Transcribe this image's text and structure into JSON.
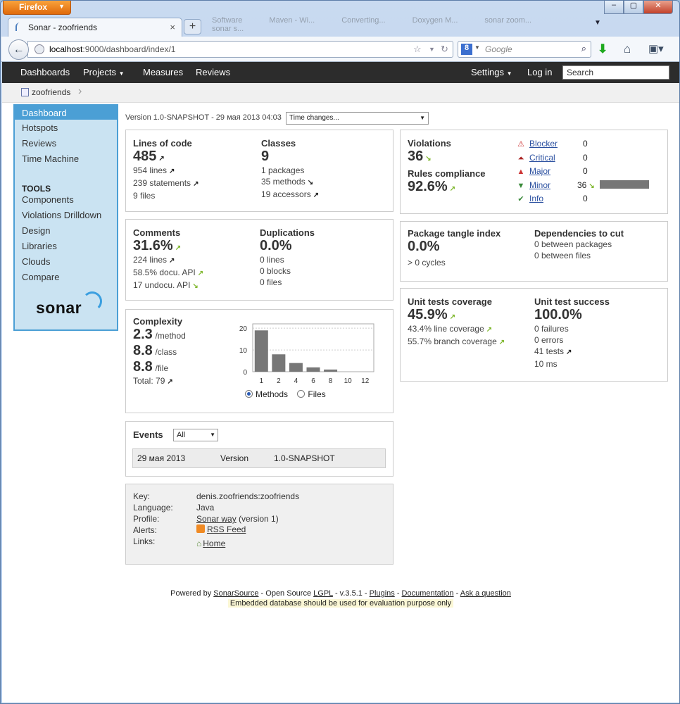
{
  "browser": {
    "app_button": "Firefox",
    "tab_title": "Sonar - zoofriends",
    "new_tab": "+",
    "url_host": "localhost",
    "url_path": ":9000/dashboard/index/1",
    "search_placeholder": "Google",
    "search_engine_letter": "8",
    "ghost_tabs": [
      "Software",
      "Maven - Wi...",
      "Converting...",
      "Doxygen M...",
      "sonar zoom...",
      "sonar s..."
    ]
  },
  "topmenu": {
    "dashboards": "Dashboards",
    "projects": "Projects",
    "measures": "Measures",
    "reviews": "Reviews",
    "settings": "Settings",
    "login": "Log in",
    "search_placeholder": "Search"
  },
  "breadcrumb": {
    "project": "zoofriends"
  },
  "sidebar": {
    "dashboard": "Dashboard",
    "hotspots": "Hotspots",
    "reviews": "Reviews",
    "time_machine": "Time Machine",
    "tools_title": "TOOLS",
    "components": "Components",
    "violations_drilldown": "Violations Drilldown",
    "design": "Design",
    "libraries": "Libraries",
    "clouds": "Clouds",
    "compare": "Compare",
    "logo": "sonar"
  },
  "header": {
    "version": "Version 1.0-SNAPSHOT - 29 мая 2013 04:03",
    "time_changes": "Time changes..."
  },
  "size": {
    "loc_title": "Lines of code",
    "loc_value": "485",
    "lines": "954 lines",
    "statements": "239 statements",
    "files": "9 files",
    "classes_title": "Classes",
    "classes_value": "9",
    "packages": "1 packages",
    "methods": "35 methods",
    "accessors": "19 accessors"
  },
  "violations": {
    "title": "Violations",
    "value": "36",
    "rules_title": "Rules compliance",
    "rules_value": "92.6%",
    "blocker": "Blocker",
    "blocker_count": "0",
    "critical": "Critical",
    "critical_count": "0",
    "major": "Major",
    "major_count": "0",
    "minor": "Minor",
    "minor_count": "36",
    "info": "Info",
    "info_count": "0"
  },
  "comments": {
    "title": "Comments",
    "value": "31.6%",
    "lines": "224 lines",
    "docu_api": "58.5% docu. API",
    "undocu_api": "17 undocu. API",
    "dup_title": "Duplications",
    "dup_value": "0.0%",
    "dup_lines": "0 lines",
    "dup_blocks": "0 blocks",
    "dup_files": "0 files"
  },
  "design": {
    "tangle_title": "Package tangle index",
    "tangle_value": "0.0%",
    "cycles": "> 0 cycles",
    "deps_title": "Dependencies to cut",
    "between_packages": "0 between packages",
    "between_files": "0 between files"
  },
  "complexity": {
    "title": "Complexity",
    "per_method": "2.3",
    "per_method_unit": "/method",
    "per_class": "8.8",
    "per_class_unit": "/class",
    "per_file": "8.8",
    "per_file_unit": "/file",
    "total": "Total: 79",
    "radio_methods": "Methods",
    "radio_files": "Files"
  },
  "tests": {
    "coverage_title": "Unit tests coverage",
    "coverage_value": "45.9%",
    "line_coverage": "43.4% line coverage",
    "branch_coverage": "55.7% branch coverage",
    "success_title": "Unit test success",
    "success_value": "100.0%",
    "failures": "0 failures",
    "errors": "0 errors",
    "tests": "41 tests",
    "duration": "10 ms"
  },
  "events": {
    "title": "Events",
    "filter": "All",
    "date": "29 мая 2013",
    "category": "Version",
    "name": "1.0-SNAPSHOT"
  },
  "info": {
    "key_label": "Key:",
    "key": "denis.zoofriends:zoofriends",
    "language_label": "Language:",
    "language": "Java",
    "profile_label": "Profile:",
    "profile_link": "Sonar way",
    "profile_version": "(version 1)",
    "alerts_label": "Alerts:",
    "rss": "RSS Feed",
    "links_label": "Links:",
    "home": "Home"
  },
  "footer": {
    "powered_by": "Powered by",
    "sonarsource": "SonarSource",
    "open_source": "- Open Source",
    "lgpl": "LGPL",
    "version": "- v.3.5.1 -",
    "plugins": "Plugins",
    "documentation": "Documentation",
    "ask": "Ask a question",
    "sep": "-",
    "warning": "Embedded database should be used for evaluation purpose only"
  },
  "chart_data": {
    "type": "bar",
    "categories": [
      "1",
      "2",
      "4",
      "6",
      "8",
      "10",
      "12"
    ],
    "values": [
      19,
      8,
      4,
      2,
      1,
      0,
      0
    ],
    "ylim": [
      0,
      22
    ],
    "yticks": [
      "0",
      "10",
      "20"
    ],
    "grid": true
  },
  "colors": {
    "accent": "#4b9fd5",
    "topbar": "#2c2c2c",
    "trend_up": "#7fb72d",
    "bar": "#777777"
  }
}
